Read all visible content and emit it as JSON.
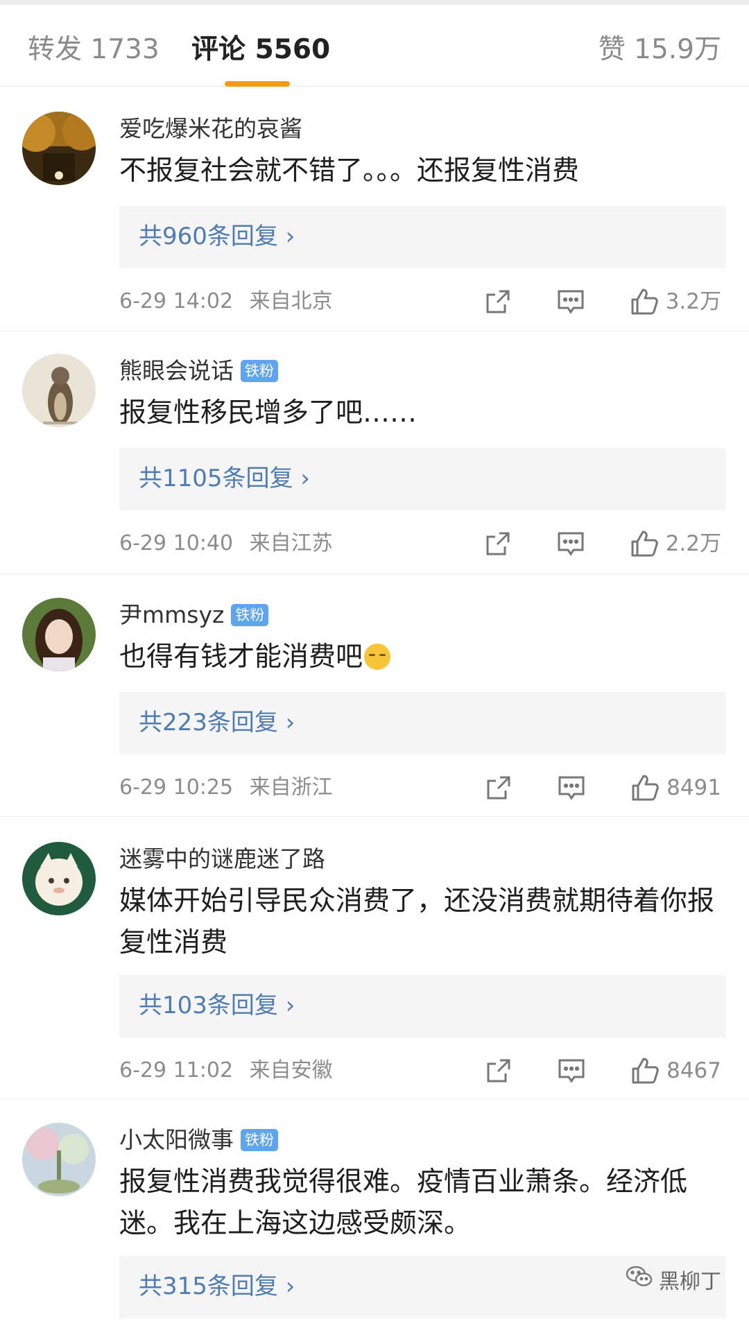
{
  "tabs": {
    "repost": "转发 1733",
    "comments": "评论 5560",
    "likes": "赞 15.9万"
  },
  "comments": [
    {
      "user": "爱吃爆米花的哀酱",
      "badge": "",
      "text": "不报复社会就不错了。。。还报复性消费",
      "replies": "共960条回复 ›",
      "time": "6-29 14:02",
      "location": "来自北京",
      "likes": "3.2万"
    },
    {
      "user": "熊眼会说话",
      "badge": "铁粉",
      "text": "报复性移民增多了吧……",
      "replies": "共1105条回复 ›",
      "time": "6-29 10:40",
      "location": "来自江苏",
      "likes": "2.2万"
    },
    {
      "user": "尹mmsyz",
      "badge": "铁粉",
      "text": "也得有钱才能消费吧",
      "replies": "共223条回复 ›",
      "time": "6-29 10:25",
      "location": "来自浙江",
      "likes": "8491"
    },
    {
      "user": "迷雾中的谜鹿迷了路",
      "badge": "",
      "text": "媒体开始引导民众消费了，还没消费就期待着你报复性消费",
      "replies": "共103条回复 ›",
      "time": "6-29 11:02",
      "location": "来自安徽",
      "likes": "8467"
    },
    {
      "user": "小太阳微事",
      "badge": "铁粉",
      "text": "报复性消费我觉得很难。疫情百业萧条。经济低迷。我在上海这边感受颇深。",
      "replies": "共315条回复 ›",
      "time": "",
      "location": "",
      "likes": ""
    }
  ],
  "watermark": "黑柳丁",
  "icons": {
    "share": "share-icon",
    "comment": "comment-icon",
    "like": "thumbs-up-icon",
    "wechat": "wechat-icon"
  },
  "colors": {
    "accent": "#f79a12",
    "reply_link": "#4f7bb3",
    "badge": "#5fa4ee"
  }
}
